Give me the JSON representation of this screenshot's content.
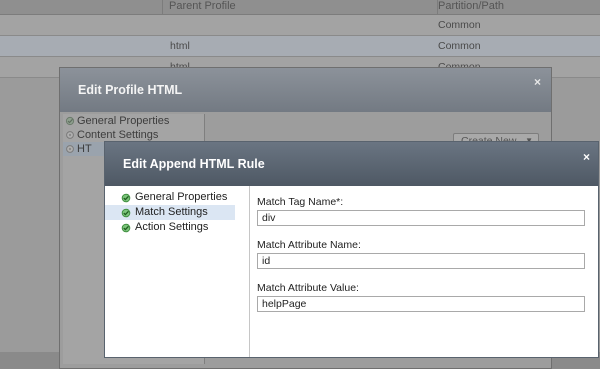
{
  "background_table": {
    "headers": [
      "",
      "Parent Profile",
      "Partition/Path"
    ],
    "rows": [
      {
        "parent": "",
        "partition": "Common"
      },
      {
        "parent": "html",
        "partition": "Common"
      },
      {
        "parent": "html",
        "partition": "Common"
      }
    ]
  },
  "profile_dialog": {
    "title": "Edit Profile HTML",
    "close": "×",
    "nav": [
      {
        "label": "General Properties",
        "icon": "check-gear-icon"
      },
      {
        "label": "Content Settings",
        "icon": "gear-icon"
      },
      {
        "label": "HT",
        "icon": "gear-icon"
      }
    ],
    "create_button": "Create New",
    "create_arrow": "▼"
  },
  "append_dialog": {
    "title": "Edit Append HTML Rule",
    "close": "×",
    "nav": [
      {
        "label": "General Properties",
        "icon": "check-gear-icon"
      },
      {
        "label": "Match Settings",
        "icon": "check-gear-icon"
      },
      {
        "label": "Action Settings",
        "icon": "check-gear-icon"
      }
    ],
    "fields": {
      "tag_label": "Match Tag Name*:",
      "tag_value": "div",
      "attr_name_label": "Match Attribute Name:",
      "attr_name_value": "id",
      "attr_value_label": "Match Attribute Value:",
      "attr_value_value": "helpPage"
    }
  }
}
